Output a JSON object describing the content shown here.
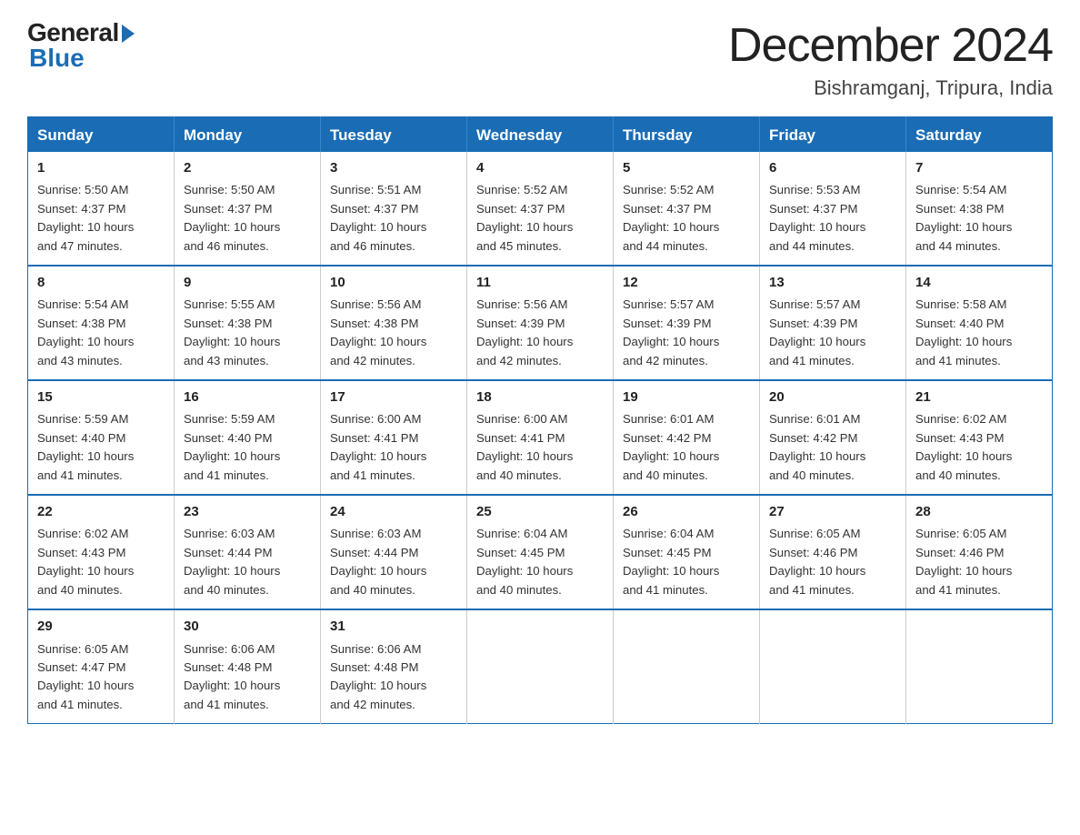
{
  "header": {
    "logo_general": "General",
    "logo_blue": "Blue",
    "month_title": "December 2024",
    "location": "Bishramganj, Tripura, India"
  },
  "calendar": {
    "days_of_week": [
      "Sunday",
      "Monday",
      "Tuesday",
      "Wednesday",
      "Thursday",
      "Friday",
      "Saturday"
    ],
    "weeks": [
      [
        {
          "day": "1",
          "info": "Sunrise: 5:50 AM\nSunset: 4:37 PM\nDaylight: 10 hours\nand 47 minutes."
        },
        {
          "day": "2",
          "info": "Sunrise: 5:50 AM\nSunset: 4:37 PM\nDaylight: 10 hours\nand 46 minutes."
        },
        {
          "day": "3",
          "info": "Sunrise: 5:51 AM\nSunset: 4:37 PM\nDaylight: 10 hours\nand 46 minutes."
        },
        {
          "day": "4",
          "info": "Sunrise: 5:52 AM\nSunset: 4:37 PM\nDaylight: 10 hours\nand 45 minutes."
        },
        {
          "day": "5",
          "info": "Sunrise: 5:52 AM\nSunset: 4:37 PM\nDaylight: 10 hours\nand 44 minutes."
        },
        {
          "day": "6",
          "info": "Sunrise: 5:53 AM\nSunset: 4:37 PM\nDaylight: 10 hours\nand 44 minutes."
        },
        {
          "day": "7",
          "info": "Sunrise: 5:54 AM\nSunset: 4:38 PM\nDaylight: 10 hours\nand 44 minutes."
        }
      ],
      [
        {
          "day": "8",
          "info": "Sunrise: 5:54 AM\nSunset: 4:38 PM\nDaylight: 10 hours\nand 43 minutes."
        },
        {
          "day": "9",
          "info": "Sunrise: 5:55 AM\nSunset: 4:38 PM\nDaylight: 10 hours\nand 43 minutes."
        },
        {
          "day": "10",
          "info": "Sunrise: 5:56 AM\nSunset: 4:38 PM\nDaylight: 10 hours\nand 42 minutes."
        },
        {
          "day": "11",
          "info": "Sunrise: 5:56 AM\nSunset: 4:39 PM\nDaylight: 10 hours\nand 42 minutes."
        },
        {
          "day": "12",
          "info": "Sunrise: 5:57 AM\nSunset: 4:39 PM\nDaylight: 10 hours\nand 42 minutes."
        },
        {
          "day": "13",
          "info": "Sunrise: 5:57 AM\nSunset: 4:39 PM\nDaylight: 10 hours\nand 41 minutes."
        },
        {
          "day": "14",
          "info": "Sunrise: 5:58 AM\nSunset: 4:40 PM\nDaylight: 10 hours\nand 41 minutes."
        }
      ],
      [
        {
          "day": "15",
          "info": "Sunrise: 5:59 AM\nSunset: 4:40 PM\nDaylight: 10 hours\nand 41 minutes."
        },
        {
          "day": "16",
          "info": "Sunrise: 5:59 AM\nSunset: 4:40 PM\nDaylight: 10 hours\nand 41 minutes."
        },
        {
          "day": "17",
          "info": "Sunrise: 6:00 AM\nSunset: 4:41 PM\nDaylight: 10 hours\nand 41 minutes."
        },
        {
          "day": "18",
          "info": "Sunrise: 6:00 AM\nSunset: 4:41 PM\nDaylight: 10 hours\nand 40 minutes."
        },
        {
          "day": "19",
          "info": "Sunrise: 6:01 AM\nSunset: 4:42 PM\nDaylight: 10 hours\nand 40 minutes."
        },
        {
          "day": "20",
          "info": "Sunrise: 6:01 AM\nSunset: 4:42 PM\nDaylight: 10 hours\nand 40 minutes."
        },
        {
          "day": "21",
          "info": "Sunrise: 6:02 AM\nSunset: 4:43 PM\nDaylight: 10 hours\nand 40 minutes."
        }
      ],
      [
        {
          "day": "22",
          "info": "Sunrise: 6:02 AM\nSunset: 4:43 PM\nDaylight: 10 hours\nand 40 minutes."
        },
        {
          "day": "23",
          "info": "Sunrise: 6:03 AM\nSunset: 4:44 PM\nDaylight: 10 hours\nand 40 minutes."
        },
        {
          "day": "24",
          "info": "Sunrise: 6:03 AM\nSunset: 4:44 PM\nDaylight: 10 hours\nand 40 minutes."
        },
        {
          "day": "25",
          "info": "Sunrise: 6:04 AM\nSunset: 4:45 PM\nDaylight: 10 hours\nand 40 minutes."
        },
        {
          "day": "26",
          "info": "Sunrise: 6:04 AM\nSunset: 4:45 PM\nDaylight: 10 hours\nand 41 minutes."
        },
        {
          "day": "27",
          "info": "Sunrise: 6:05 AM\nSunset: 4:46 PM\nDaylight: 10 hours\nand 41 minutes."
        },
        {
          "day": "28",
          "info": "Sunrise: 6:05 AM\nSunset: 4:46 PM\nDaylight: 10 hours\nand 41 minutes."
        }
      ],
      [
        {
          "day": "29",
          "info": "Sunrise: 6:05 AM\nSunset: 4:47 PM\nDaylight: 10 hours\nand 41 minutes."
        },
        {
          "day": "30",
          "info": "Sunrise: 6:06 AM\nSunset: 4:48 PM\nDaylight: 10 hours\nand 41 minutes."
        },
        {
          "day": "31",
          "info": "Sunrise: 6:06 AM\nSunset: 4:48 PM\nDaylight: 10 hours\nand 42 minutes."
        },
        {
          "day": "",
          "info": ""
        },
        {
          "day": "",
          "info": ""
        },
        {
          "day": "",
          "info": ""
        },
        {
          "day": "",
          "info": ""
        }
      ]
    ]
  }
}
